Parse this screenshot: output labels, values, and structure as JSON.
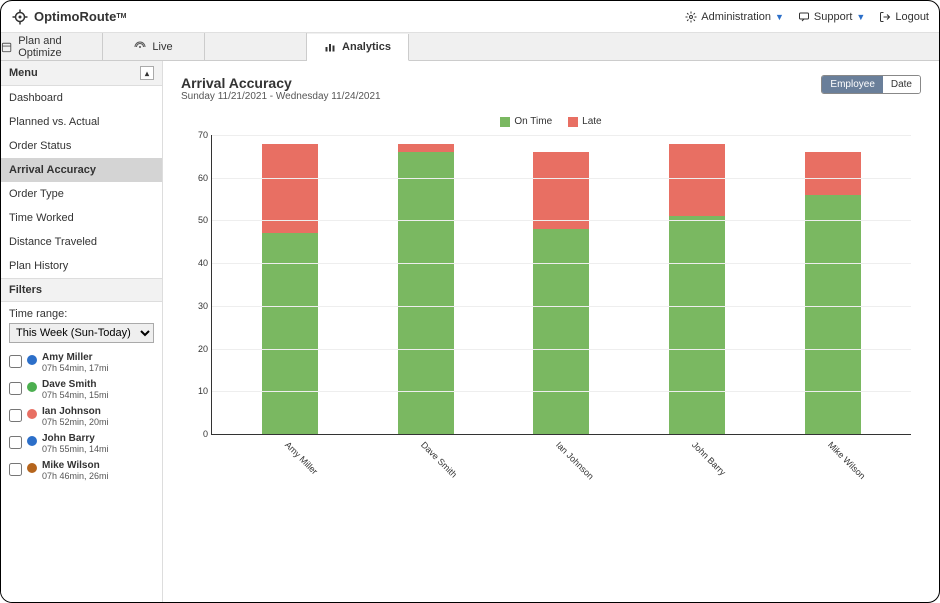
{
  "brand": "OptimoRoute",
  "tm": "TM",
  "top_nav": {
    "admin": "Administration",
    "support": "Support",
    "logout": "Logout"
  },
  "tabs": {
    "plan": "Plan and Optimize",
    "live": "Live",
    "analytics": "Analytics"
  },
  "sidebar": {
    "menu_label": "Menu",
    "items": [
      "Dashboard",
      "Planned vs. Actual",
      "Order Status",
      "Arrival Accuracy",
      "Order Type",
      "Time Worked",
      "Distance Traveled",
      "Plan History"
    ],
    "active_index": 3,
    "filters_label": "Filters",
    "time_range_label": "Time range:",
    "time_range_value": "This Week (Sun-Today)"
  },
  "drivers": [
    {
      "name": "Amy Miller",
      "stats": "07h 54min, 17mi",
      "color": "#2c6fc9"
    },
    {
      "name": "Dave Smith",
      "stats": "07h 54min, 15mi",
      "color": "#4caf50"
    },
    {
      "name": "Ian Johnson",
      "stats": "07h 52min, 20mi",
      "color": "#e86f63"
    },
    {
      "name": "John Barry",
      "stats": "07h 55min, 14mi",
      "color": "#2c6fc9"
    },
    {
      "name": "Mike Wilson",
      "stats": "07h 46min, 26mi",
      "color": "#b5651d"
    }
  ],
  "page": {
    "title": "Arrival Accuracy",
    "subtitle": "Sunday 11/21/2021 - Wednesday 11/24/2021",
    "toggle": {
      "employee": "Employee",
      "date": "Date"
    }
  },
  "chart_data": {
    "type": "bar",
    "stacked": true,
    "categories": [
      "Amy Miller",
      "Dave Smith",
      "Ian Johnson",
      "John Barry",
      "Mike Wilson"
    ],
    "series": [
      {
        "name": "On Time",
        "color": "#7ab861",
        "values": [
          47,
          66,
          48,
          51,
          56
        ]
      },
      {
        "name": "Late",
        "color": "#e86f63",
        "values": [
          21,
          2,
          18,
          17,
          10
        ]
      }
    ],
    "ylabel": "",
    "xlabel": "",
    "ylim": [
      0,
      70
    ],
    "yticks": [
      0,
      10,
      20,
      30,
      40,
      50,
      60,
      70
    ],
    "legend": [
      "On Time",
      "Late"
    ]
  }
}
